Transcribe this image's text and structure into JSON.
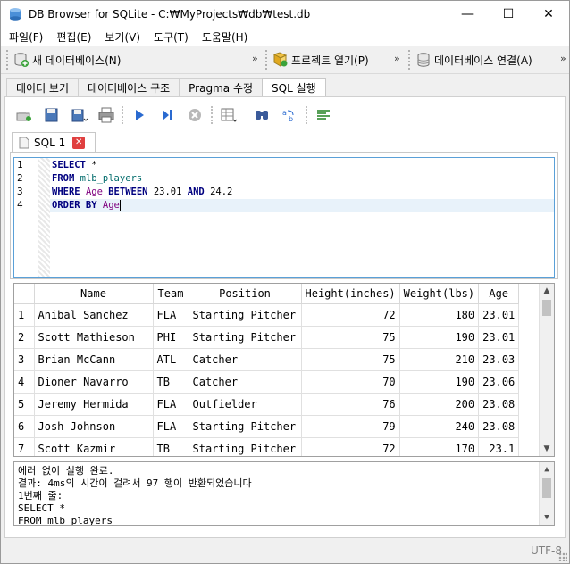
{
  "window": {
    "title": "DB Browser for SQLite - C:₩MyProjects₩db₩test.db",
    "minimize_glyph": "—",
    "maximize_glyph": "☐",
    "close_glyph": "✕"
  },
  "menu": [
    "파일(F)",
    "편집(E)",
    "보기(V)",
    "도구(T)",
    "도움말(H)"
  ],
  "toolbar1": {
    "new_db": "새 데이터베이스(N)",
    "open_project": "프로젝트 열기(P)",
    "attach_db": "데이터베이스 연결(A)",
    "chevron": "»"
  },
  "main_tabs": [
    "데이터 보기",
    "데이터베이스 구조",
    "Pragma 수정",
    "SQL 실행"
  ],
  "main_tab_active": "SQL 실행",
  "sql_tab": {
    "label": "SQL 1",
    "close_glyph": "✕"
  },
  "editor": {
    "line_numbers": [
      "1",
      "2",
      "3",
      "4"
    ],
    "lines": [
      {
        "kw1": "SELECT",
        "rest": " *"
      },
      {
        "kw1": "FROM",
        "table": "mlb_players"
      },
      {
        "kw1": "WHERE",
        "col": "Age",
        "kw2": "BETWEEN",
        "v1": "23.01",
        "kw3": "AND",
        "v2": "24.2"
      },
      {
        "kw1": "ORDER BY",
        "col": "Age"
      }
    ]
  },
  "results": {
    "columns": [
      "Name",
      "Team",
      "Position",
      "Height(inches)",
      "Weight(lbs)",
      "Age"
    ],
    "rows": [
      [
        "1",
        "Anibal Sanchez",
        "FLA",
        "Starting Pitcher",
        "72",
        "180",
        "23.01"
      ],
      [
        "2",
        "Scott Mathieson",
        "PHI",
        "Starting Pitcher",
        "75",
        "190",
        "23.01"
      ],
      [
        "3",
        "Brian McCann",
        "ATL",
        "Catcher",
        "75",
        "210",
        "23.03"
      ],
      [
        "4",
        "Dioner Navarro",
        "TB",
        "Catcher",
        "70",
        "190",
        "23.06"
      ],
      [
        "5",
        "Jeremy Hermida",
        "FLA",
        "Outfielder",
        "76",
        "200",
        "23.08"
      ],
      [
        "6",
        "Josh Johnson",
        "FLA",
        "Starting Pitcher",
        "79",
        "240",
        "23.08"
      ],
      [
        "7",
        "Scott Kazmir",
        "TB",
        "Starting Pitcher",
        "72",
        "170",
        "23.1"
      ]
    ]
  },
  "messages": [
    "에러 없이 실행 완료.",
    "결과: 4ms의 시간이 걸려서 97 행이 반환되었습니다",
    "1번째 줄:",
    "SELECT *",
    "FROM mlb_players"
  ],
  "status": {
    "encoding": "UTF-8"
  }
}
